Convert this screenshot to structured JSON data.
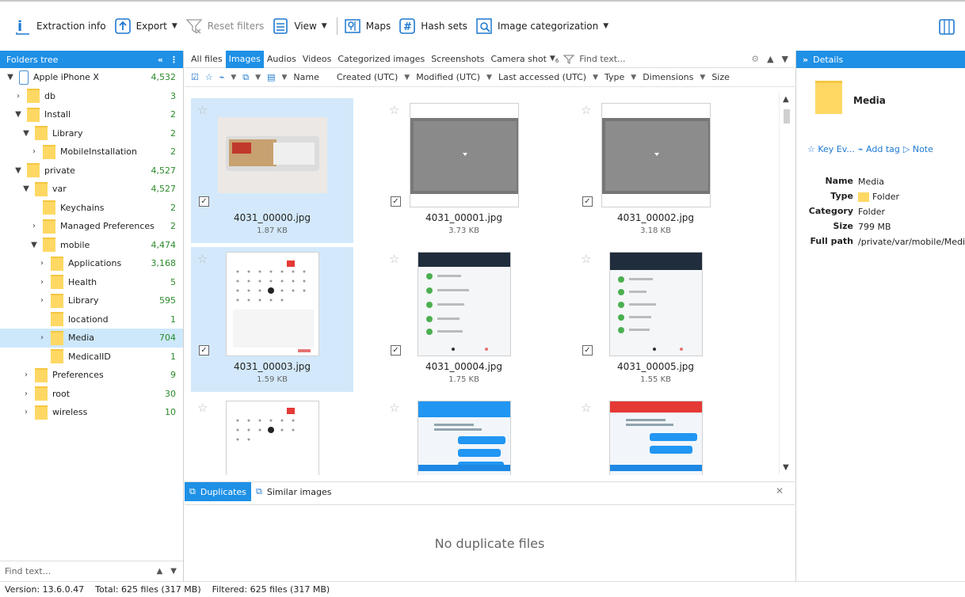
{
  "toolbar": {
    "extraction": "Extraction info",
    "export": "Export",
    "reset": "Reset filters",
    "view": "View",
    "maps": "Maps",
    "hashsets": "Hash sets",
    "categorization": "Image categorization"
  },
  "folders": {
    "title": "Folders tree",
    "rows": [
      {
        "label": "Apple iPhone X",
        "count": "4,532"
      },
      {
        "label": "db",
        "count": "3"
      },
      {
        "label": "Install",
        "count": "2"
      },
      {
        "label": "Library",
        "count": "2"
      },
      {
        "label": "MobileInstallation",
        "count": "2"
      },
      {
        "label": "private",
        "count": "4,527"
      },
      {
        "label": "var",
        "count": "4,527"
      },
      {
        "label": "Keychains",
        "count": "2"
      },
      {
        "label": "Managed Preferences",
        "count": "2"
      },
      {
        "label": "mobile",
        "count": "4,474"
      },
      {
        "label": "Applications",
        "count": "3,168"
      },
      {
        "label": "Health",
        "count": "5"
      },
      {
        "label": "Library",
        "count": "595"
      },
      {
        "label": "locationd",
        "count": "1"
      },
      {
        "label": "Media",
        "count": "704"
      },
      {
        "label": "MedicalID",
        "count": "1"
      },
      {
        "label": "Preferences",
        "count": "9"
      },
      {
        "label": "root",
        "count": "30"
      },
      {
        "label": "wireless",
        "count": "10"
      }
    ],
    "search_placeholder": "Find text..."
  },
  "tabs": [
    "All files",
    "Images",
    "Audios",
    "Videos",
    "Categorized images",
    "Screenshots",
    "Camera shot"
  ],
  "tab_find": "Find text...",
  "tab_filter_count": "6",
  "columns": {
    "name": "Name",
    "created": "Created (UTC)",
    "modified": "Modified (UTC)",
    "accessed": "Last accessed (UTC)",
    "type": "Type",
    "dimensions": "Dimensions",
    "size": "Size"
  },
  "files": [
    {
      "name": "4031_00000.jpg",
      "size": "1.87 KB"
    },
    {
      "name": "4031_00001.jpg",
      "size": "3.73 KB"
    },
    {
      "name": "4031_00002.jpg",
      "size": "3.18 KB"
    },
    {
      "name": "4031_00003.jpg",
      "size": "1.59 KB"
    },
    {
      "name": "4031_00004.jpg",
      "size": "1.75 KB"
    },
    {
      "name": "4031_00005.jpg",
      "size": "1.55 KB"
    }
  ],
  "duplicates": {
    "tab1": "Duplicates",
    "tab2": "Similar images",
    "empty": "No duplicate files"
  },
  "details": {
    "title": "Details",
    "name": "Media",
    "actions": {
      "key": "Key Ev...",
      "tag": "Add tag",
      "note": "Note"
    },
    "props": {
      "name_k": "Name",
      "name_v": "Media",
      "type_k": "Type",
      "type_v": "Folder",
      "cat_k": "Category",
      "cat_v": "Folder",
      "size_k": "Size",
      "size_v": "799 MB",
      "path_k": "Full path",
      "path_v": "/private/var/mobile/Media"
    }
  },
  "status": {
    "version": "Version: 13.6.0.47",
    "total": "Total: 625 files (317 MB)",
    "filtered": "Filtered: 625 files (317 MB)"
  },
  "colors": {
    "accent": "#1e90e6",
    "selection": "#cde8fb",
    "count": "#2a8a2a"
  }
}
